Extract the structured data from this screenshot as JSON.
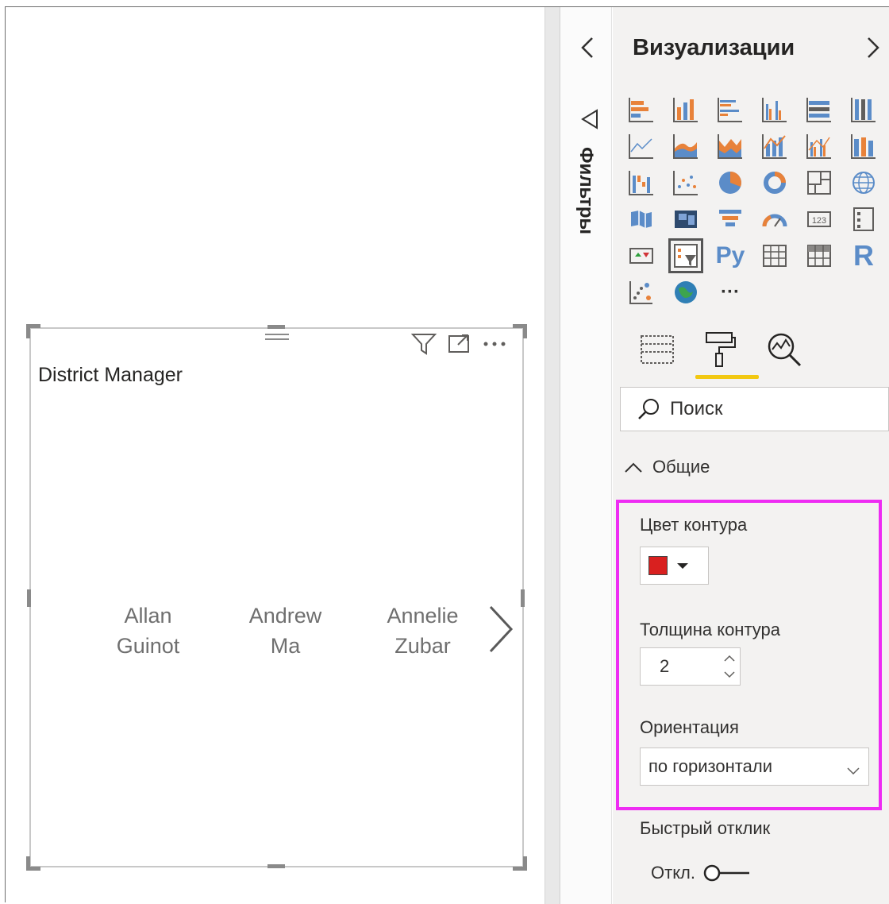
{
  "visual": {
    "title": "District Manager",
    "items": [
      {
        "line1": "Allan",
        "line2": "Guinot"
      },
      {
        "line1": "Andrew",
        "line2": "Ma"
      },
      {
        "line1": "Annelie",
        "line2": "Zubar"
      }
    ],
    "toolbar_icons": [
      "filter-icon",
      "focus-mode-icon",
      "more-options-icon"
    ]
  },
  "filters_pane": {
    "label": "Фильтры"
  },
  "visualizations_pane": {
    "title": "Визуализации",
    "icons": [
      "stacked-bar-chart",
      "stacked-column-chart",
      "clustered-bar-chart",
      "clustered-column-chart",
      "100-stacked-bar-chart",
      "100-stacked-column-chart",
      "line-chart",
      "area-chart",
      "stacked-area-chart",
      "line-and-stacked-column-chart",
      "line-and-clustered-column-chart",
      "ribbon-chart",
      "waterfall-chart",
      "scatter-chart",
      "pie-chart",
      "donut-chart",
      "treemap",
      "map",
      "filled-map",
      "shape-map",
      "funnel",
      "gauge",
      "card",
      "multi-row-card",
      "kpi",
      "slicer",
      "python-visual",
      "table",
      "matrix",
      "r-visual",
      "key-influencers",
      "arcgis-map",
      "more-visuals"
    ],
    "python_label": "Py",
    "r_label": "R",
    "more_label": "···",
    "tabs": [
      "fields-tab",
      "format-tab",
      "analytics-tab"
    ],
    "active_tab": "format-tab",
    "search_placeholder": "Поиск",
    "section_label": "Общие",
    "outline_color_label": "Цвет контура",
    "outline_color": "#d9201f",
    "outline_weight_label": "Толщина контура",
    "outline_weight_value": "2",
    "orientation_label": "Ориентация",
    "orientation_value": "по горизонтали",
    "responsive_label": "Быстрый отклик",
    "responsive_toggle": "Откл."
  },
  "colors": {
    "highlight": "#ee2cf3",
    "accent": "#f2c811",
    "chart_orange": "#e8823a",
    "chart_blue": "#5b8cc8"
  }
}
